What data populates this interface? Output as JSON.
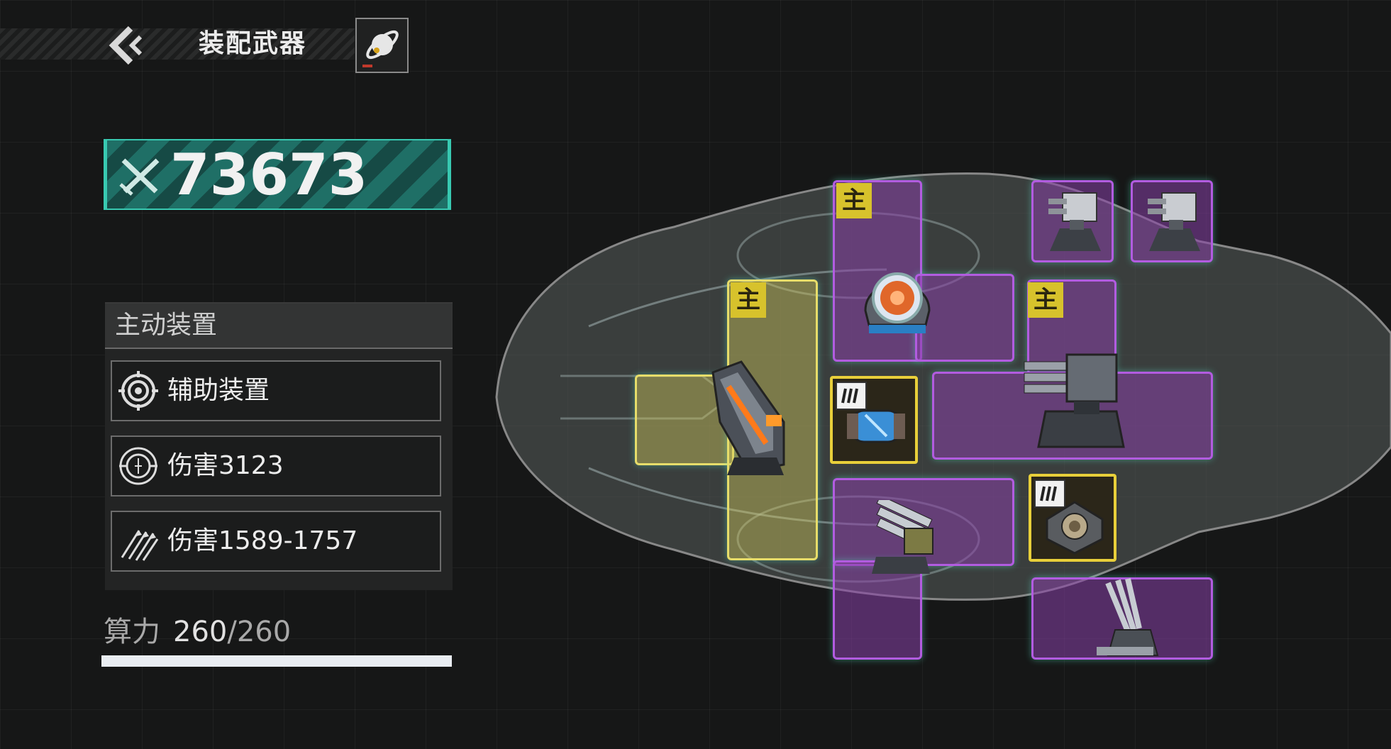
{
  "header": {
    "title": "装配武器"
  },
  "power": {
    "value": "73673"
  },
  "devices": {
    "header": "主动装置",
    "items": [
      {
        "label": "辅助装置",
        "icon": "target-icon"
      },
      {
        "label": "伤害3123",
        "icon": "crosshair-icon"
      },
      {
        "label": "伤害1589-1757",
        "icon": "missile-volley-icon"
      }
    ]
  },
  "compute": {
    "label": "算力",
    "current": "260",
    "separator": "/",
    "max": "260",
    "fill_ratio": 1.0
  },
  "slots": {
    "main_badge": "主",
    "weapons": [
      {
        "name": "laser-cannon",
        "slot_color": "yellow",
        "main": true
      },
      {
        "name": "plasma-core",
        "slot_color": "purple",
        "main": true
      },
      {
        "name": "twin-turret-1",
        "slot_color": "purple",
        "main": false
      },
      {
        "name": "twin-turret-2",
        "slot_color": "purple",
        "main": false
      },
      {
        "name": "heavy-gatling",
        "slot_color": "purple",
        "main": true
      },
      {
        "name": "energy-capsule",
        "slot_color": "gold-module",
        "main": false
      },
      {
        "name": "missile-pod",
        "slot_color": "purple",
        "main": false
      },
      {
        "name": "armor-plate-module",
        "slot_color": "gold-module",
        "main": false
      },
      {
        "name": "rocket-launcher",
        "slot_color": "purple",
        "main": false
      }
    ]
  },
  "colors": {
    "accent_teal": "#38c9b1",
    "slot_purple": "#b25ce0",
    "slot_yellow": "#e7dd6a",
    "main_badge": "#d7c22c"
  }
}
